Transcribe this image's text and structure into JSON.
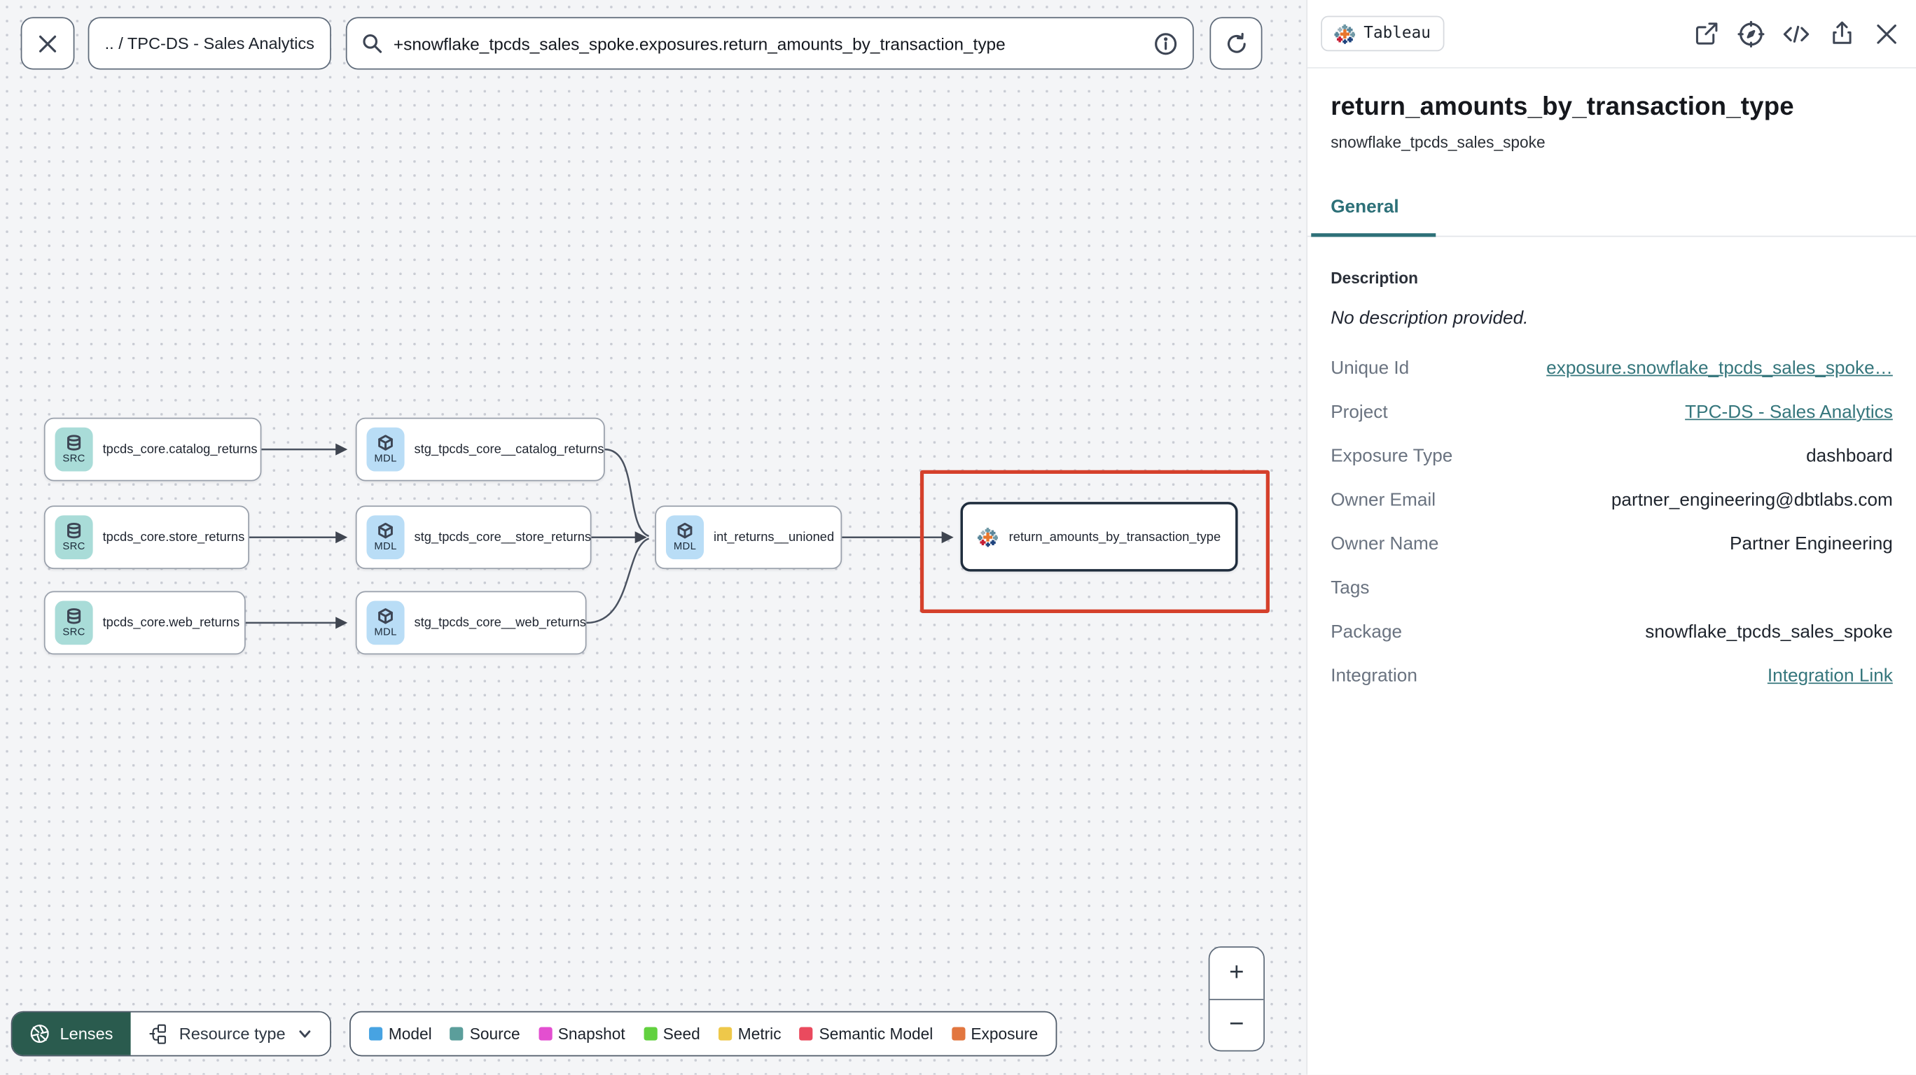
{
  "top_bar": {
    "breadcrumb": ".. / TPC-DS - Sales Analytics",
    "search_value": "+snowflake_tpcds_sales_spoke.exposures.return_amounts_by_transaction_type",
    "icons": [
      "close-icon",
      "search-icon",
      "info-icon",
      "refresh-icon"
    ]
  },
  "graph": {
    "nodes": [
      {
        "badge": "SRC",
        "label": "tpcds_core.catalog_returns"
      },
      {
        "badge": "SRC",
        "label": "tpcds_core.store_returns"
      },
      {
        "badge": "SRC",
        "label": "tpcds_core.web_returns"
      },
      {
        "badge": "MDL",
        "label": "stg_tpcds_core__catalog_returns"
      },
      {
        "badge": "MDL",
        "label": "stg_tpcds_core__store_returns"
      },
      {
        "badge": "MDL",
        "label": "stg_tpcds_core__web_returns"
      },
      {
        "badge": "MDL",
        "label": "int_returns__unioned"
      }
    ],
    "exposure": {
      "label": "return_amounts_by_transaction_type",
      "icon": "tableau-logo"
    },
    "highlight_color": "#d5402b"
  },
  "lenses": {
    "label": "Lenses",
    "resource_type_label": "Resource type"
  },
  "legend": {
    "items": [
      {
        "label": "Model",
        "color": "#47a3e2"
      },
      {
        "label": "Source",
        "color": "#5b9e9b"
      },
      {
        "label": "Snapshot",
        "color": "#e34fd0"
      },
      {
        "label": "Seed",
        "color": "#62d13f"
      },
      {
        "label": "Metric",
        "color": "#eec84a"
      },
      {
        "label": "Semantic Model",
        "color": "#ea4a5e"
      },
      {
        "label": "Exposure",
        "color": "#e2763f"
      }
    ]
  },
  "zoom_controls": {
    "zoom_in": "+",
    "zoom_out": "−"
  },
  "panel": {
    "integration_badge": "Tableau",
    "header_icons": [
      "open-in-new-icon",
      "explore-icon",
      "code-icon",
      "share-icon",
      "close-icon"
    ],
    "title": "return_amounts_by_transaction_type",
    "subtitle": "snowflake_tpcds_sales_spoke",
    "tabs": [
      {
        "label": "General"
      }
    ],
    "description_label": "Description",
    "description_value": "No description provided.",
    "accent_color": "#2d7078",
    "fields": [
      {
        "label": "Unique Id",
        "value": "exposure.snowflake_tpcds_sales_spoke…",
        "link": true
      },
      {
        "label": "Project",
        "value": "TPC-DS - Sales Analytics",
        "link": true
      },
      {
        "label": "Exposure Type",
        "value": "dashboard",
        "link": false
      },
      {
        "label": "Owner Email",
        "value": "partner_engineering@dbtlabs.com",
        "link": false
      },
      {
        "label": "Owner Name",
        "value": "Partner Engineering",
        "link": false
      },
      {
        "label": "Tags",
        "value": "",
        "link": false
      },
      {
        "label": "Package",
        "value": "snowflake_tpcds_sales_spoke",
        "link": false
      },
      {
        "label": "Integration",
        "value": "Integration Link",
        "link": true
      }
    ]
  }
}
